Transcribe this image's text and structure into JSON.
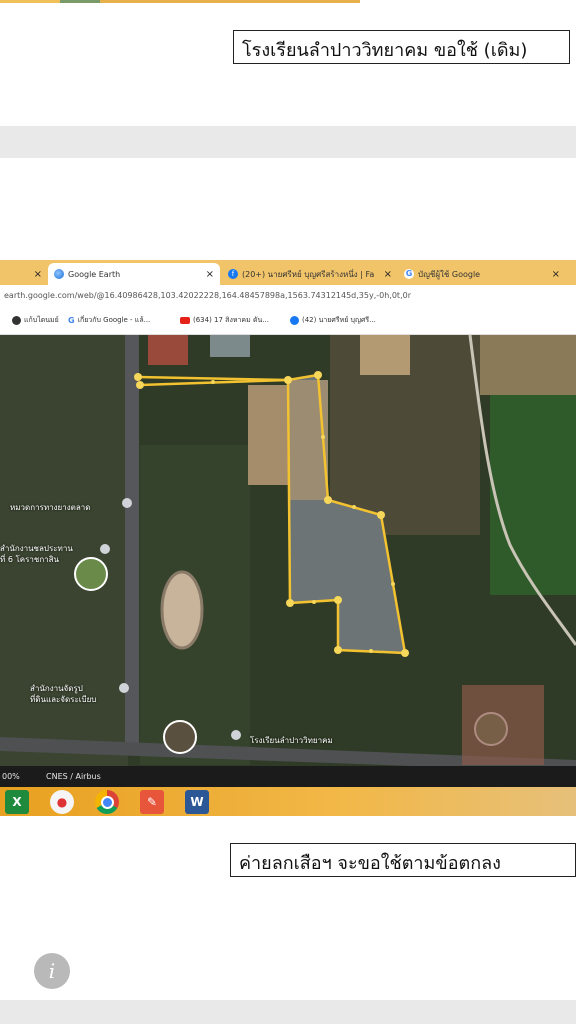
{
  "page1": {
    "caption": "โรงเรียนลำปาววิทยาคม ขอใช้ (เดิม)"
  },
  "browser": {
    "tabs": [
      {
        "label": "",
        "close": "×"
      },
      {
        "label": "Google Earth",
        "close": "×"
      },
      {
        "label": "(20+) นายศรีหย์ บุญศรีสร้างหนึ่ง | Fa",
        "close": "×"
      },
      {
        "label": "บัญชีผู้ใช้ Google",
        "close": "×"
      }
    ],
    "address": "earth.google.com/web/@16.40986428,103.42022228,164.48457898a,1563.74312145d,35y,-0h,0t,0r",
    "bookmarks": [
      {
        "label": "แก้บไดนมย์",
        "icon": "globe-icon"
      },
      {
        "label": "เกี่ยวกับ Google - แล้...",
        "icon": "google-icon"
      },
      {
        "label": "(634) 17 สิงหาคม ดัน...",
        "icon": "youtube-icon"
      },
      {
        "label": "(42) นายศรีหย์ บุญศรี...",
        "icon": "facebook-icon"
      }
    ]
  },
  "map": {
    "labels": {
      "district_office": "หมวดการทางยางตลาด",
      "office_6": "สำนักงานชลประทาน",
      "office_6_line2": "ที่ 6 โคราชกาสิน",
      "office_land": "สำนักงานจัดรูป",
      "office_land_line2": "ที่ดินและจัดระเบียบ",
      "school": "โรงเรียนลำปาววิทยาคม"
    },
    "footer_zoom": "00%",
    "footer_credit": "CNES / Airbus",
    "boundary_color": "#f2c230"
  },
  "taskbar": {
    "apps": [
      "excel-icon",
      "security-icon",
      "chrome-icon",
      "paint-icon",
      "word-icon"
    ]
  },
  "page2": {
    "caption": "ค่ายลกเสือฯ จะขอใช้ตามข้อตกลง"
  },
  "viewer": {
    "info_glyph": "i"
  }
}
